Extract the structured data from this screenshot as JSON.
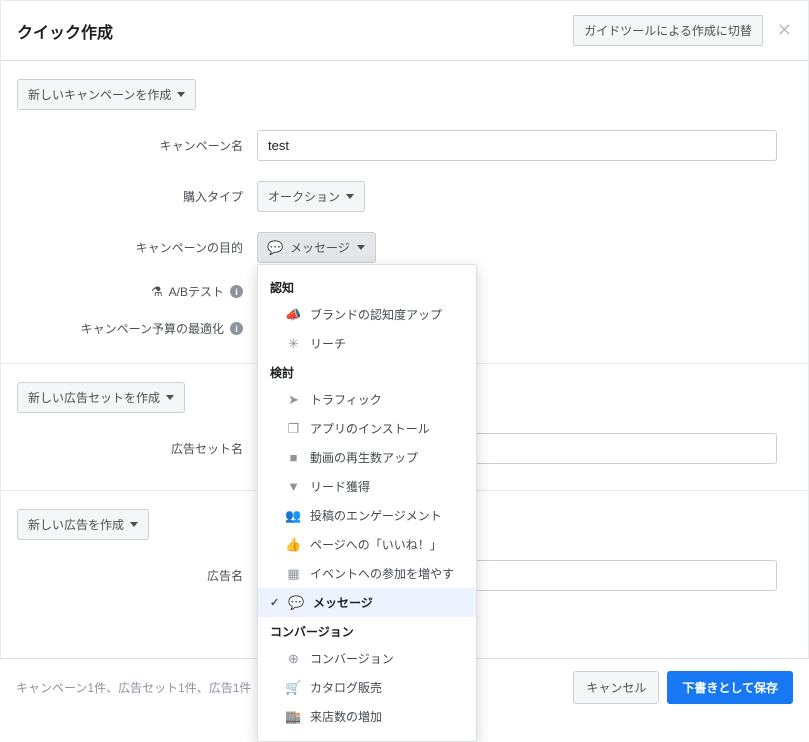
{
  "header": {
    "title": "クイック作成",
    "switch_label": "ガイドツールによる作成に切替"
  },
  "campaign": {
    "create_dd": "新しいキャンペーンを作成",
    "name_label": "キャンペーン名",
    "name_value": "test",
    "buy_type_label": "購入タイプ",
    "buy_type_value": "オークション",
    "objective_label": "キャンペーンの目的",
    "objective_value": "メッセージ",
    "ab_test_label": "A/Bテスト",
    "budget_opt_label": "キャンペーン予算の最適化"
  },
  "adset": {
    "create_dd": "新しい広告セットを作成",
    "name_label": "広告セット名"
  },
  "ad": {
    "create_dd": "新しい広告を作成",
    "name_label": "広告名"
  },
  "objective_menu": {
    "g1": "認知",
    "i_brand": "ブランドの認知度アップ",
    "i_reach": "リーチ",
    "g2": "検討",
    "i_traffic": "トラフィック",
    "i_app": "アプリのインストール",
    "i_video": "動画の再生数アップ",
    "i_lead": "リード獲得",
    "i_engage": "投稿のエンゲージメント",
    "i_likes": "ページへの「いいね！」",
    "i_event": "イベントへの参加を増やす",
    "i_msg": "メッセージ",
    "g3": "コンバージョン",
    "i_conv": "コンバージョン",
    "i_catalog": "カタログ販売",
    "i_store": "来店数の増加"
  },
  "footer": {
    "status": "キャンペーン1件、広告セット1件、広告1件",
    "cancel": "キャンセル",
    "save_draft": "下書きとして保存"
  }
}
